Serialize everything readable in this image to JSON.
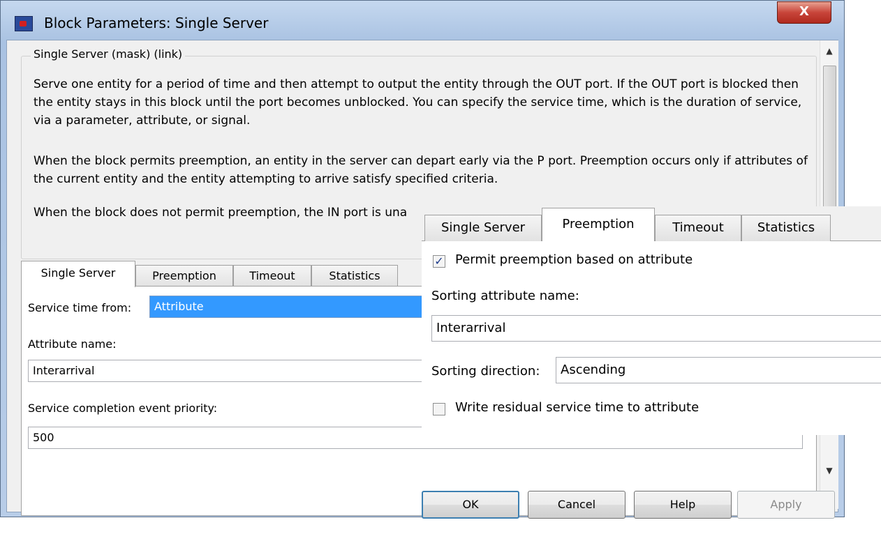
{
  "window": {
    "title": "Block Parameters: Single Server",
    "close_label": "X"
  },
  "description": {
    "group_title": "Single Server (mask) (link)",
    "para1": "Serve one entity for a period of time and then attempt to output the entity through the OUT port. If the OUT port is blocked then the entity stays in this block until the port becomes unblocked. You can specify the service time, which is the duration of service, via a parameter, attribute, or signal.",
    "para2": "When the block permits preemption, an entity in the server can depart early via the P port. Preemption occurs only if attributes of the current entity and the entity attempting to arrive satisfy specified criteria.",
    "para3": "When the block does not permit preemption, the IN port is una"
  },
  "main_tabs": [
    {
      "label": "Single Server",
      "active": true
    },
    {
      "label": "Preemption",
      "active": false
    },
    {
      "label": "Timeout",
      "active": false
    },
    {
      "label": "Statistics",
      "active": false
    }
  ],
  "single_server": {
    "service_time_label": "Service time from:",
    "service_time_value": "Attribute",
    "attribute_name_label": "Attribute name:",
    "attribute_name_value": "Interarrival",
    "priority_label": "Service completion event priority:",
    "priority_value": "500"
  },
  "buttons": {
    "ok": "OK",
    "cancel": "Cancel",
    "help": "Help",
    "apply": "Apply"
  },
  "overlay": {
    "tabs": [
      {
        "label": "Single Server",
        "active": false
      },
      {
        "label": "Preemption",
        "active": true
      },
      {
        "label": "Timeout",
        "active": false
      },
      {
        "label": "Statistics",
        "active": false
      }
    ],
    "permit_label": "Permit preemption based on attribute",
    "permit_checked": true,
    "sorting_attr_label": "Sorting attribute name:",
    "sorting_attr_value": "Interarrival",
    "sorting_dir_label": "Sorting direction:",
    "sorting_dir_value": "Ascending",
    "write_residual_label": "Write residual service time to attribute",
    "write_residual_checked": false
  },
  "colors": {
    "selection_blue": "#3399ff",
    "close_red": "#c8453a"
  }
}
